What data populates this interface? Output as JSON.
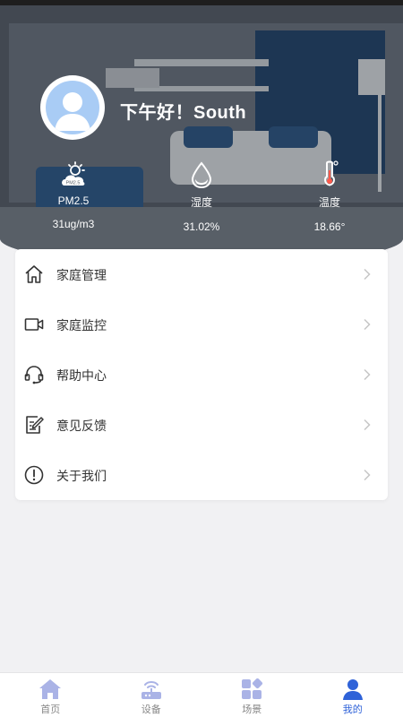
{
  "header": {
    "greeting": "下午好！South"
  },
  "stats": [
    {
      "label": "PM2.5",
      "value": "31ug/m3",
      "icon": "cloud-sun-icon"
    },
    {
      "label": "湿度",
      "value": "31.02%",
      "icon": "water-drop-icon"
    },
    {
      "label": "温度",
      "value": "18.66°",
      "icon": "thermometer-icon"
    }
  ],
  "pm_badge": "PM2.5",
  "menu": [
    {
      "label": "家庭管理",
      "icon": "home-icon"
    },
    {
      "label": "家庭监控",
      "icon": "video-camera-icon"
    },
    {
      "label": "帮助中心",
      "icon": "headset-icon"
    },
    {
      "label": "意见反馈",
      "icon": "feedback-edit-icon"
    },
    {
      "label": "关于我们",
      "icon": "info-circle-icon"
    }
  ],
  "tabs": [
    {
      "label": "首页",
      "icon": "home-tab-icon",
      "active": false
    },
    {
      "label": "设备",
      "icon": "router-icon",
      "active": false
    },
    {
      "label": "场景",
      "icon": "scenes-grid-icon",
      "active": false
    },
    {
      "label": "我的",
      "icon": "user-icon",
      "active": true
    }
  ],
  "colors": {
    "accent": "#2f62d8",
    "tab_inactive_icon": "#aab3e6",
    "avatar": "#a9ccf5",
    "background": "#f1f1f3"
  }
}
